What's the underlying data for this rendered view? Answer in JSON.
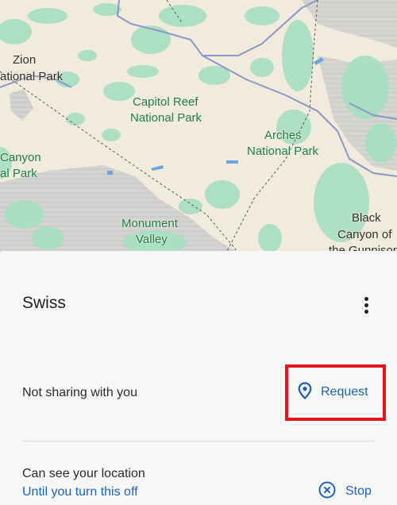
{
  "map": {
    "labels": {
      "zion": "Zion",
      "zion_2": "ational Park",
      "capitol_reef": "Capitol Reef",
      "capitol_reef_2": "National Park",
      "arches": "Arches",
      "arches_2": "National Park",
      "canyon": "Canyon",
      "canyon_2": "al Park",
      "monument": "Monument",
      "monument_2": "Valley",
      "black_canyon": "Black",
      "black_canyon_2": "Canyon of",
      "black_canyon_3": "the Gunnison"
    },
    "colors": {
      "land": "#f0ebdc",
      "park": "#a8dfc0",
      "road": "#8c96c8",
      "water": "#6aa5e0",
      "reservation": "#c9c9c9"
    }
  },
  "sheet": {
    "contact_name": "Swiss",
    "more_icon": "more-vertical-icon",
    "status": "Not sharing with you",
    "request_label": "Request",
    "request_icon": "location-pin-icon",
    "can_see": "Can see your location",
    "until": "Until you turn this off",
    "stop_label": "Stop",
    "stop_icon": "close-circle-icon",
    "highlight_color": "#e3151d",
    "accent_color": "#1a64bf"
  }
}
